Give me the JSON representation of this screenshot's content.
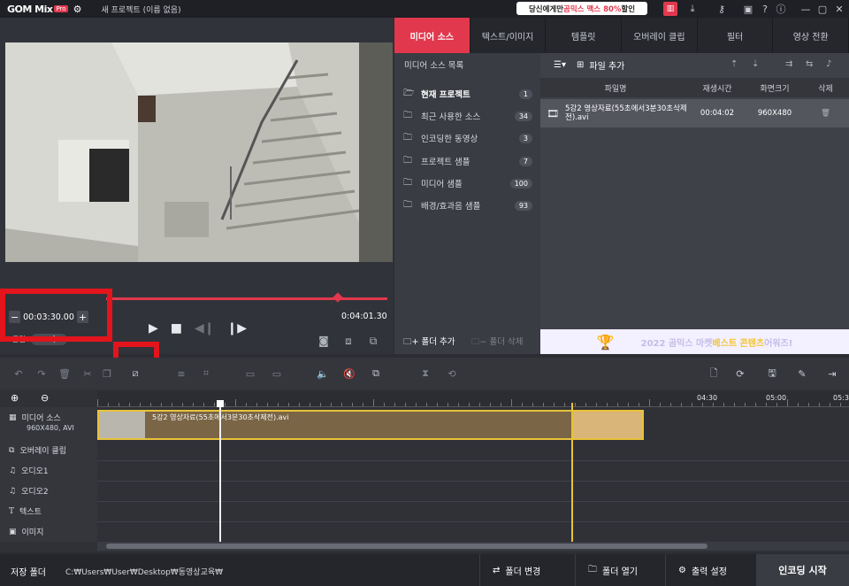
{
  "titlebar": {
    "logo": "GOM Mix",
    "logo_pro": "Pro",
    "project_title": "새 프로젝트 (이름 없음)",
    "promo_prefix": "당신에게만 ",
    "promo_highlight": "곰믹스 맥스 80%",
    "promo_suffix": " 할인"
  },
  "preview": {
    "time_value": "00:03:30.00",
    "minus": "−",
    "plus": "+",
    "mode_clip": "클립",
    "mode_project": "프로젝트",
    "duration": "0:04:01.30"
  },
  "tabs": [
    {
      "label": "미디어 소스",
      "active": true
    },
    {
      "label": "텍스트/이미지",
      "active": false
    },
    {
      "label": "템플릿",
      "active": false
    },
    {
      "label": "오버레이 클립",
      "active": false
    },
    {
      "label": "필터",
      "active": false
    },
    {
      "label": "영상 전환",
      "active": false
    }
  ],
  "media_source": {
    "header": "미디어 소스 목록",
    "items": [
      {
        "label": "현재 프로젝트",
        "count": "1"
      },
      {
        "label": "최근 사용한 소스",
        "count": "34"
      },
      {
        "label": "인코딩한 동영상",
        "count": "3"
      },
      {
        "label": "프로젝트 샘플",
        "count": "7"
      },
      {
        "label": "미디어 샘플",
        "count": "100"
      },
      {
        "label": "배경/효과음 샘플",
        "count": "93"
      }
    ],
    "folder_add": "폴더 추가",
    "folder_delete": "폴더 삭제",
    "add_file": "파일 추가"
  },
  "file_table": {
    "headers": {
      "name": "파일명",
      "duration": "재생시간",
      "size": "화면크기",
      "delete": "삭제"
    },
    "rows": [
      {
        "name": "5강2 영상자료(55초에서3분30초삭제전).avi",
        "duration": "00:04:02",
        "size": "960X480"
      }
    ]
  },
  "banner": {
    "year": "2022 곰믹스 마켓 ",
    "highlight": "베스트 콘텐츠",
    "suffix": " 어워즈!"
  },
  "timeline": {
    "ruler": [
      "04:30",
      "05:00",
      "05:3"
    ],
    "tracks": [
      {
        "name": "미디어 소스",
        "sub": "960X480, AVI",
        "icon": "film-icon"
      },
      {
        "name": "오버레이 클립",
        "icon": "overlay-icon"
      },
      {
        "name": "오디오1",
        "icon": "music-icon"
      },
      {
        "name": "오디오2",
        "icon": "music-icon"
      },
      {
        "name": "텍스트",
        "icon": "text-icon"
      },
      {
        "name": "이미지",
        "icon": "image-icon"
      }
    ],
    "clip_label": "5강2 영상자료(55초에서3분30초삭제전).avi"
  },
  "bottombar": {
    "save_label": "저장 폴더",
    "save_path": "C:₩Users₩User₩Desktop₩동영상교육₩",
    "change_folder": "폴더 변경",
    "open_folder": "폴더 열기",
    "output_settings": "출력 설정",
    "start_encoding": "인코딩 시작"
  },
  "colors": {
    "accent": "#e2384d",
    "highlight_box": "#e3141c",
    "clip_border": "#e8c23a"
  }
}
